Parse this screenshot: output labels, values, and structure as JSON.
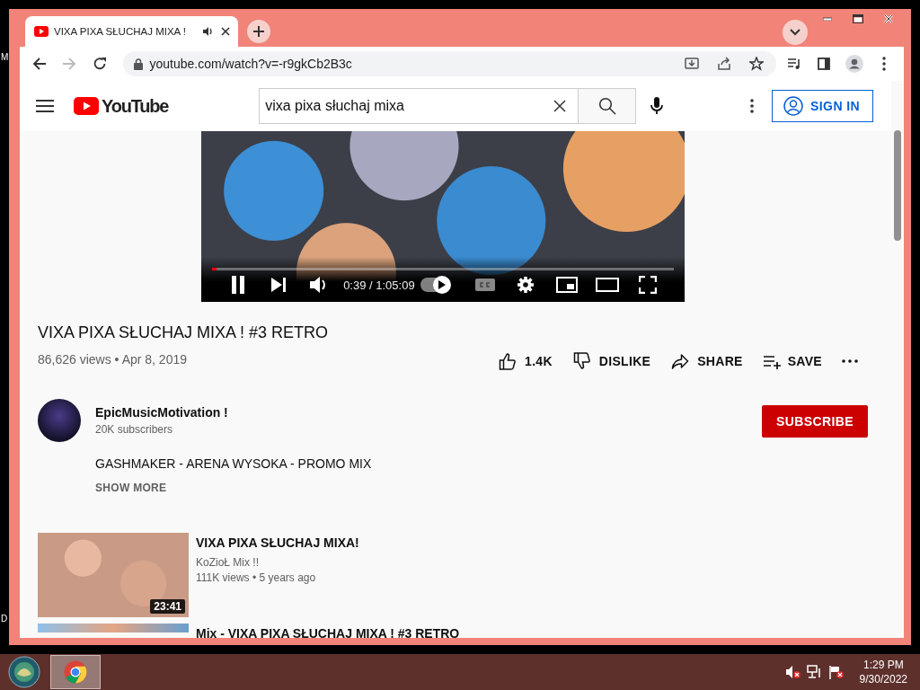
{
  "desktop": {
    "icon_labels": [
      "M",
      "D"
    ]
  },
  "browser": {
    "tab_title": "VIXA PIXA SŁUCHAJ MIXA !",
    "url": "youtube.com/watch?v=-r9gkCb2B3c"
  },
  "header": {
    "logo": "YouTube",
    "search": {
      "value": "vixa pixa słuchaj mixa"
    },
    "sign_in": "SIGN IN"
  },
  "player": {
    "time": "0:39 / 1:05:09",
    "progress": {
      "level": 0.01
    },
    "autoplay": {
      "on": true
    }
  },
  "video": {
    "title": "VIXA PIXA SŁUCHAJ MIXA ! #3 RETRO",
    "meta": "86,626 views • Apr 8, 2019",
    "actions": [
      {
        "kind": "like",
        "label": "1.4K"
      },
      {
        "kind": "dislike",
        "label": "DISLIKE"
      },
      {
        "kind": "share",
        "label": "SHARE"
      },
      {
        "kind": "save",
        "label": "SAVE"
      },
      {
        "kind": "more"
      }
    ]
  },
  "channel": {
    "name": "EpicMusicMotivation !",
    "subscribers": "20K subscribers",
    "subscribe": "SUBSCRIBE"
  },
  "description": {
    "text": "GASHMAKER - ARENA WYSOKA - PROMO MIX",
    "show_more": "SHOW MORE"
  },
  "related": [
    {
      "title": "VIXA PIXA SŁUCHAJ MIXA!",
      "channel": "KoZioŁ Mix !!",
      "meta": "111K views • 5 years ago",
      "duration": "23:41"
    },
    {
      "title": "Mix - VIXA PIXA SŁUCHAJ MIXA ! #3 RETRO"
    }
  ],
  "taskbar": {
    "time": "1:29 PM",
    "date": "9/30/2022"
  }
}
